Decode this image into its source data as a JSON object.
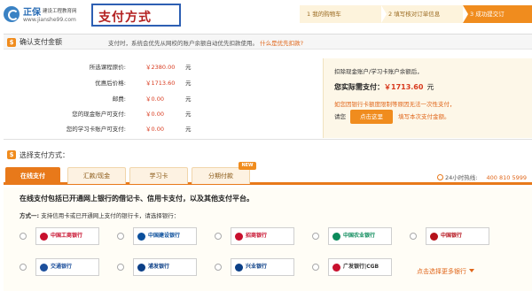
{
  "header": {
    "logo_name": "正保",
    "logo_sub": "建设工程教育网",
    "logo_url": "www.jianshe99.com",
    "page_title": "支付方式"
  },
  "steps": [
    {
      "label": "1 我的购物车",
      "active": false
    },
    {
      "label": "2 填写核对订单信息",
      "active": false
    },
    {
      "label": "3 成功提交订",
      "active": true
    }
  ],
  "confirm": {
    "badge": "$",
    "title": "确认支付金额",
    "note": "支付时，系统会优先从网校的账户余额自动优先扣款使用。",
    "link": "什么是优先扣款?"
  },
  "summary_rows": [
    {
      "label": "所选课程原价:",
      "value": "￥2380.00",
      "unit": "元"
    },
    {
      "label": "优惠后价格:",
      "value": "￥1713.60",
      "unit": "元"
    },
    {
      "label": "邮费:",
      "value": "￥0.00",
      "unit": "元"
    },
    {
      "label": "您的现金账户可支付:",
      "value": "￥0.00",
      "unit": "元"
    },
    {
      "label": "您的学习卡账户可支付:",
      "value": "￥0.00",
      "unit": "元"
    }
  ],
  "pay_box": {
    "line1": "扣除现金账户/学习卡账户余额后，",
    "line2": "您实际需支付：",
    "amount": "￥1713.60",
    "unit": "元",
    "line3": "如您因银行卡额度限制等原因无法一次性支付，",
    "prompt": "请您",
    "button": "点击这里",
    "suffix": "填写本次支付金额。"
  },
  "select": {
    "title": "选择支付方式：",
    "tabs": [
      "在线支付",
      "汇款/现金",
      "学习卡",
      "分期付款"
    ],
    "new_badge": "NEW",
    "hotline_label": "24小时热线:",
    "hotline_number": "400 810 5999"
  },
  "online": {
    "title": "在线支付包括已开通网上银行的借记卡、信用卡支付，以及其他支付平台。",
    "method_label": "方式一:",
    "method_text": "支持信用卡或已开通网上支付的银行卡，请选择银行：",
    "banks": [
      {
        "name": "中国工商银行",
        "color": "#c8102e"
      },
      {
        "name": "中国建设银行",
        "color": "#0b4f9c"
      },
      {
        "name": "招商银行",
        "color": "#c8102e"
      },
      {
        "name": "中国农业银行",
        "color": "#0a8a5a"
      },
      {
        "name": "中国银行",
        "color": "#b5121b"
      },
      {
        "name": "交通银行",
        "color": "#1c4f9c"
      },
      {
        "name": "浦发银行",
        "color": "#0b3f87"
      },
      {
        "name": "兴业银行",
        "color": "#0b3f87"
      },
      {
        "name": "广发银行|CGB",
        "color": "#c8102e"
      }
    ],
    "more": "点击选择更多银行"
  }
}
